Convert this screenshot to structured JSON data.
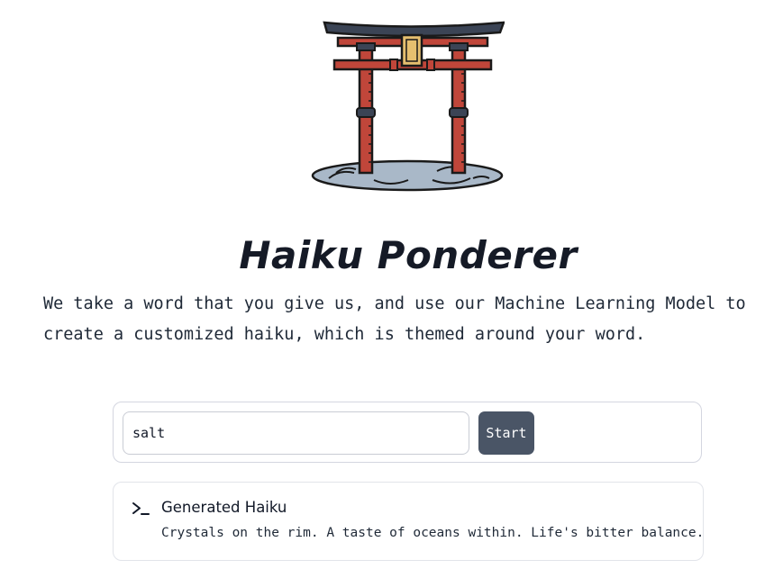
{
  "header": {
    "logo_icon": "torii-gate-icon",
    "title": "Haiku Ponderer",
    "description": "We take a word that you give us, and use our Machine Learning Model to create a customized haiku, which is themed around your word."
  },
  "form": {
    "word_value": "salt",
    "start_label": "Start"
  },
  "output": {
    "icon": "terminal-icon",
    "title": "Generated Haiku",
    "haiku": "Crystals on the rim. A taste of oceans within. Life's bitter balance."
  },
  "colors": {
    "button": "#4a5566",
    "gate_red": "#c0463a",
    "gate_roof": "#3b4455",
    "water": "#a9b8c8"
  }
}
